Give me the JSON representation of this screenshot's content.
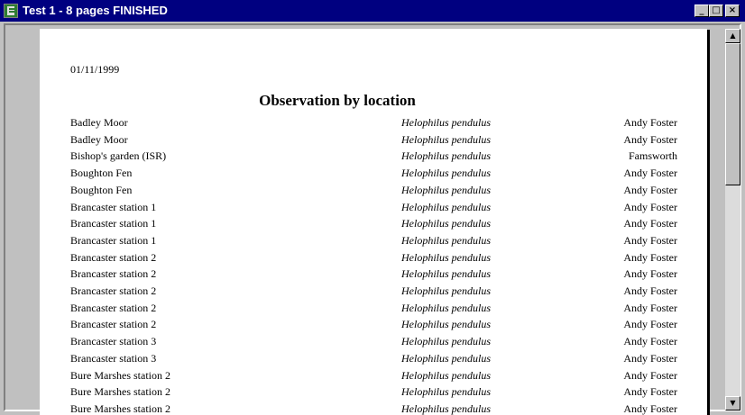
{
  "window": {
    "title": "Test 1 - 8 pages FINISHED"
  },
  "report": {
    "date": "01/11/1999",
    "title": "Observation by location",
    "rows": [
      {
        "location": "Badley Moor",
        "species": "Helophilus pendulus",
        "recorder": "Andy Foster"
      },
      {
        "location": "Badley Moor",
        "species": "Helophilus pendulus",
        "recorder": "Andy Foster"
      },
      {
        "location": "Bishop's garden (ISR)",
        "species": "Helophilus pendulus",
        "recorder": "Famsworth"
      },
      {
        "location": "Boughton Fen",
        "species": "Helophilus pendulus",
        "recorder": "Andy Foster"
      },
      {
        "location": "Boughton Fen",
        "species": "Helophilus pendulus",
        "recorder": "Andy Foster"
      },
      {
        "location": "Brancaster station 1",
        "species": "Helophilus pendulus",
        "recorder": "Andy Foster"
      },
      {
        "location": "Brancaster station 1",
        "species": "Helophilus pendulus",
        "recorder": "Andy Foster"
      },
      {
        "location": "Brancaster station 1",
        "species": "Helophilus pendulus",
        "recorder": "Andy Foster"
      },
      {
        "location": "Brancaster station 2",
        "species": "Helophilus pendulus",
        "recorder": "Andy Foster"
      },
      {
        "location": "Brancaster station 2",
        "species": "Helophilus pendulus",
        "recorder": "Andy Foster"
      },
      {
        "location": "Brancaster station 2",
        "species": "Helophilus pendulus",
        "recorder": "Andy Foster"
      },
      {
        "location": "Brancaster station 2",
        "species": "Helophilus pendulus",
        "recorder": "Andy Foster"
      },
      {
        "location": "Brancaster station 2",
        "species": "Helophilus pendulus",
        "recorder": "Andy Foster"
      },
      {
        "location": "Brancaster station 3",
        "species": "Helophilus pendulus",
        "recorder": "Andy Foster"
      },
      {
        "location": "Brancaster station 3",
        "species": "Helophilus pendulus",
        "recorder": "Andy Foster"
      },
      {
        "location": "Bure Marshes station 2",
        "species": "Helophilus pendulus",
        "recorder": "Andy Foster"
      },
      {
        "location": "Bure Marshes station 2",
        "species": "Helophilus pendulus",
        "recorder": "Andy Foster"
      },
      {
        "location": "Bure Marshes station 2",
        "species": "Helophilus pendulus",
        "recorder": "Andy Foster"
      }
    ]
  },
  "icons": {
    "app": "report-app-icon",
    "minimize": "minimize-icon",
    "maximize": "maximize-icon",
    "close": "close-icon",
    "scroll_up": "up-arrow-icon",
    "scroll_down": "down-arrow-icon"
  },
  "colors": {
    "titlebar": "#000080",
    "chrome": "#c0c0c0",
    "page": "#ffffff"
  }
}
